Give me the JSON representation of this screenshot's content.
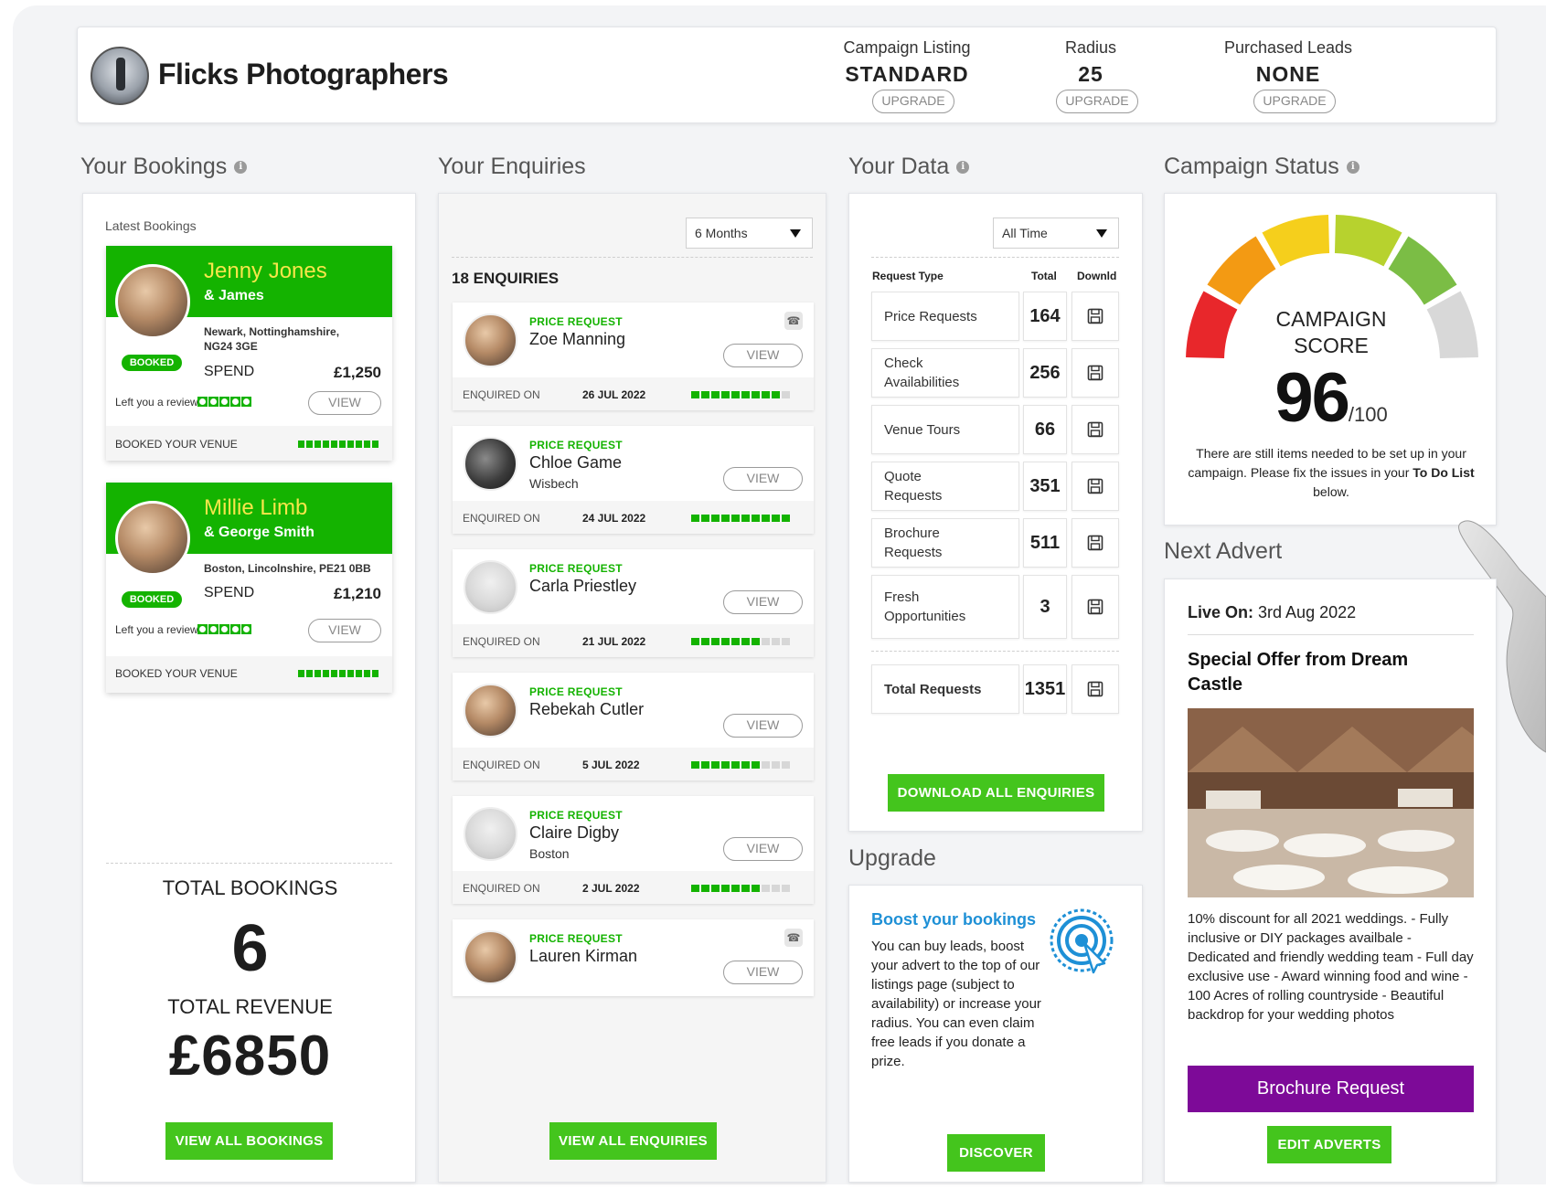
{
  "header": {
    "brand": "Flicks Photographers",
    "stats": [
      {
        "label": "Campaign Listing",
        "value": "STANDARD",
        "button": "UPGRADE"
      },
      {
        "label": "Radius",
        "value": "25",
        "button": "UPGRADE"
      },
      {
        "label": "Purchased Leads",
        "value": "NONE",
        "button": "UPGRADE"
      }
    ]
  },
  "bookings": {
    "title": "Your Bookings",
    "subtitle": "Latest Bookings",
    "items": [
      {
        "name": "Jenny Jones",
        "partner": "& James",
        "address_line1": "Newark, Nottinghamshire,",
        "address_line2": "NG24 3GE",
        "status": "BOOKED",
        "spend_label": "SPEND",
        "spend": "£1,250",
        "review_text": "Left you a review",
        "view": "VIEW",
        "footer": "BOOKED YOUR VENUE"
      },
      {
        "name": "Millie Limb",
        "partner": "& George Smith",
        "address_line1": "Boston, Lincolnshire, PE21 0BB",
        "address_line2": "",
        "status": "BOOKED",
        "spend_label": "SPEND",
        "spend": "£1,210",
        "review_text": "Left you a review",
        "view": "VIEW",
        "footer": "BOOKED YOUR VENUE"
      }
    ],
    "total_bookings_label": "TOTAL BOOKINGS",
    "total_bookings": "6",
    "total_revenue_label": "TOTAL REVENUE",
    "total_revenue": "£6850",
    "button": "VIEW ALL BOOKINGS"
  },
  "enquiries": {
    "title": "Your Enquiries",
    "filter": "6 Months",
    "count_label": "18 ENQUIRIES",
    "enquired_label": "ENQUIRED ON",
    "items": [
      {
        "type": "PRICE REQUEST",
        "name": "Zoe Manning",
        "location": "",
        "date": "26 JUL 2022",
        "view": "VIEW",
        "progress": 0.9,
        "phone": true
      },
      {
        "type": "PRICE REQUEST",
        "name": "Chloe Game",
        "location": "Wisbech",
        "date": "24 JUL 2022",
        "view": "VIEW",
        "progress": 1.0,
        "phone": false
      },
      {
        "type": "PRICE REQUEST",
        "name": "Carla Priestley",
        "location": "",
        "date": "21 JUL 2022",
        "view": "VIEW",
        "progress": 0.7,
        "phone": false
      },
      {
        "type": "PRICE REQUEST",
        "name": "Rebekah Cutler",
        "location": "",
        "date": "5 JUL 2022",
        "view": "VIEW",
        "progress": 0.7,
        "phone": false
      },
      {
        "type": "PRICE REQUEST",
        "name": "Claire Digby",
        "location": "Boston",
        "date": "2 JUL 2022",
        "view": "VIEW",
        "progress": 0.7,
        "phone": false
      },
      {
        "type": "PRICE REQUEST",
        "name": "Lauren Kirman",
        "location": "",
        "date": "",
        "view": "VIEW",
        "progress": 0,
        "phone": true
      }
    ],
    "button": "VIEW ALL ENQUIRIES"
  },
  "data": {
    "title": "Your Data",
    "filter": "All Time",
    "columns": [
      "Request Type",
      "Total",
      "Downld"
    ],
    "rows": [
      {
        "type": "Price Requests",
        "total": "164"
      },
      {
        "type": "Check Availabilities",
        "total": "256"
      },
      {
        "type": "Venue Tours",
        "total": "66"
      },
      {
        "type": "Quote Requests",
        "total": "351"
      },
      {
        "type": "Brochure Requests",
        "total": "511"
      },
      {
        "type": "Fresh Opportunities",
        "total": "3"
      }
    ],
    "total_row": {
      "type": "Total Requests",
      "total": "1351"
    },
    "button": "DOWNLOAD ALL ENQUIRIES"
  },
  "upgrade": {
    "title": "Upgrade",
    "heading": "Boost your bookings",
    "body": "You can buy leads, boost your advert to the top of our listings page (subject to availability) or increase your radius. You can even claim free leads if you donate a prize.",
    "button": "DISCOVER"
  },
  "campaign": {
    "title": "Campaign Status",
    "score_label_1": "CAMPAIGN",
    "score_label_2": "SCORE",
    "score": "96",
    "score_max": "/100",
    "score_value": 96,
    "message_1": "There are still items needed to be set up in your campaign. Please fix the issues in your",
    "message_bold": "To Do List",
    "message_2": "below.",
    "gauge_colors": [
      "#e8272b",
      "#f39a13",
      "#f5cf1c",
      "#b7d22e",
      "#7bbd45",
      "#d8d8d8"
    ]
  },
  "advert": {
    "title": "Next Advert",
    "live_label": "Live On:",
    "live_date": "3rd Aug 2022",
    "heading": "Special Offer from Dream Castle",
    "body": "10% discount for all 2021 weddings. - Fully inclusive or DIY packages availbale - Dedicated and friendly wedding team - Full day exclusive use - Award winning food and wine - 100 Acres of rolling countryside - Beautiful backdrop for your wedding photos",
    "cta": "Brochure Request",
    "button": "EDIT ADVERTS"
  },
  "colors": {
    "accent_green": "#44c51d",
    "booking_green": "#14b300",
    "upgrade_blue": "#1e90d6",
    "cta_purple": "#7d0a98"
  }
}
